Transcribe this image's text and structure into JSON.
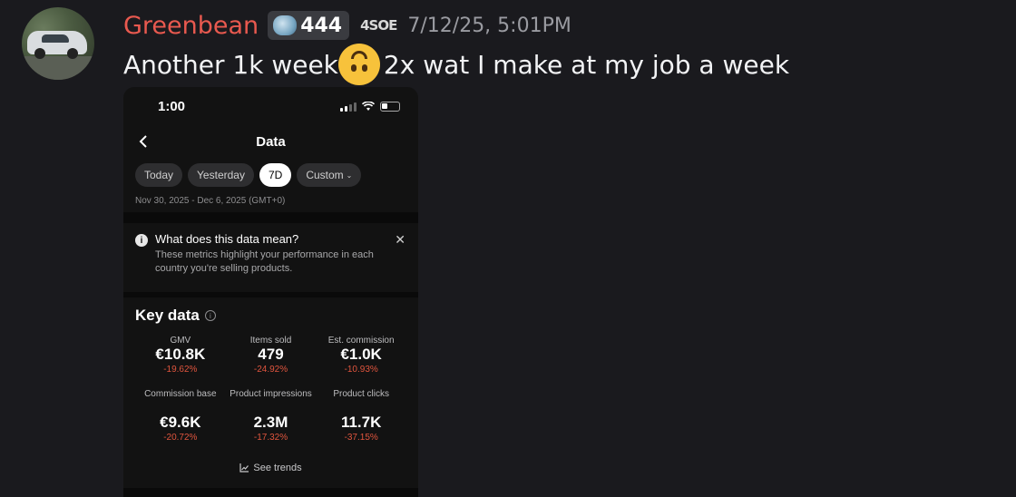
{
  "post": {
    "username": "Greenbean",
    "role_count": "444",
    "clan_tag": "4SOE",
    "timestamp": "7/12/25, 5:01PM",
    "message_before": "Another 1k week",
    "message_after": "2x wat I make at my job a week"
  },
  "phone": {
    "status_time": "1:00",
    "title": "Data",
    "filters": [
      {
        "label": "Today"
      },
      {
        "label": "Yesterday"
      },
      {
        "label": "7D"
      },
      {
        "label": "Custom"
      }
    ],
    "date_range": "Nov 30, 2025 - Dec 6, 2025 (GMT+0)",
    "info_title": "What does this data mean?",
    "info_text": "These metrics highlight your performance in each country you're selling products.",
    "key_title": "Key data",
    "metrics_row1": [
      {
        "label": "GMV",
        "value": "€10.8K",
        "change": "-19.62%"
      },
      {
        "label": "Items sold",
        "value": "479",
        "change": "-24.92%"
      },
      {
        "label": "Est. commission",
        "value": "€1.0K",
        "change": "-10.93%"
      }
    ],
    "metrics_row2": [
      {
        "label": "Commission base",
        "value": "€9.6K",
        "change": "-20.72%"
      },
      {
        "label": "Product impressions",
        "value": "2.3M",
        "change": "-17.32%"
      },
      {
        "label": "Product clicks",
        "value": "11.7K",
        "change": "-37.15%"
      }
    ],
    "see_trends": "See trends"
  },
  "colors": {
    "username": "#e8594f",
    "background": "#1a1a1e",
    "negative_change": "#e0553e"
  }
}
